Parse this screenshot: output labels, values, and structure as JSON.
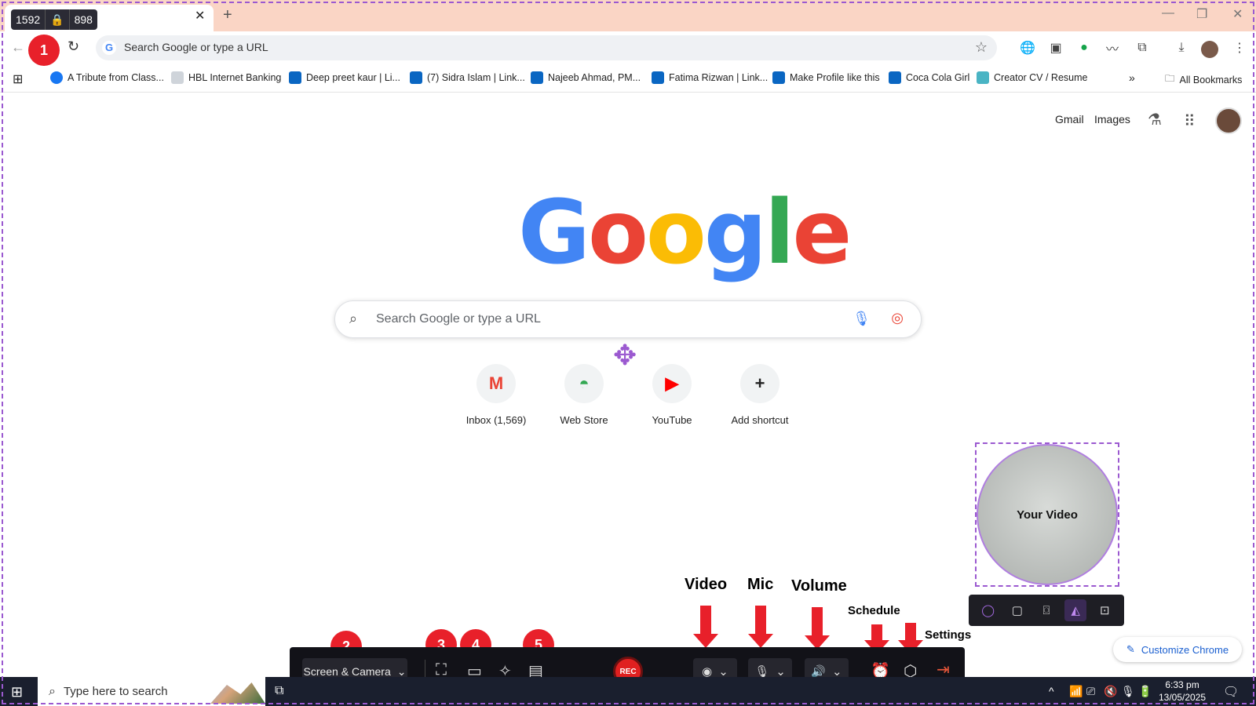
{
  "capture": {
    "width": "1592",
    "height": "898"
  },
  "browser": {
    "address_placeholder": "Search Google or type a URL",
    "bookmarks": [
      {
        "label": "A Tribute from Class...",
        "icon": "facebook-icon",
        "color": "#1877f2"
      },
      {
        "label": "HBL Internet Banking",
        "icon": "page-icon",
        "color": "#cfd4da"
      },
      {
        "label": "Deep preet kaur | Li...",
        "icon": "linkedin-icon",
        "color": "#0a66c2"
      },
      {
        "label": "(7) Sidra Islam | Link...",
        "icon": "linkedin-icon",
        "color": "#0a66c2"
      },
      {
        "label": "Najeeb Ahmad, PM...",
        "icon": "linkedin-icon",
        "color": "#0a66c2"
      },
      {
        "label": "Fatima Rizwan | Link...",
        "icon": "linkedin-icon",
        "color": "#0a66c2"
      },
      {
        "label": "Make Profile like this",
        "icon": "linkedin-icon",
        "color": "#0a66c2"
      },
      {
        "label": "Coca Cola Girl",
        "icon": "linkedin-icon",
        "color": "#0a66c2"
      },
      {
        "label": "Creator CV / Resume",
        "icon": "doc-icon",
        "color": "#4ab4c4"
      }
    ],
    "all_bookmarks": "All Bookmarks"
  },
  "google": {
    "gmail": "Gmail",
    "images": "Images",
    "logo": [
      "G",
      "o",
      "o",
      "g",
      "l",
      "e"
    ],
    "logo_colors": [
      "#4285f4",
      "#ea4335",
      "#fbbc05",
      "#4285f4",
      "#34a853",
      "#ea4335"
    ],
    "search_placeholder": "Search Google or type a URL",
    "shortcuts": [
      {
        "label": "Inbox (1,569)",
        "icon": "gmail-icon"
      },
      {
        "label": "Web Store",
        "icon": "webstore-icon"
      },
      {
        "label": "YouTube",
        "icon": "youtube-icon"
      },
      {
        "label": "Add shortcut",
        "icon": "plus-icon"
      }
    ],
    "customize": "Customize Chrome"
  },
  "camera": {
    "label": "Your Video"
  },
  "recorder": {
    "mode": "Screen & Camera",
    "rec_label": "REC"
  },
  "annotations": {
    "numbers": [
      "1",
      "2",
      "3",
      "4",
      "5"
    ],
    "video": "Video",
    "mic": "Mic",
    "volume": "Volume",
    "schedule": "Schedule",
    "settings": "Settings"
  },
  "taskbar": {
    "search_placeholder": "Type here to search",
    "time": "6:33 pm",
    "date": "13/05/2025"
  },
  "colors": {
    "accent": "#9b59d0",
    "annotation_red": "#e8202a",
    "tab_strip": "#fad5c5"
  }
}
